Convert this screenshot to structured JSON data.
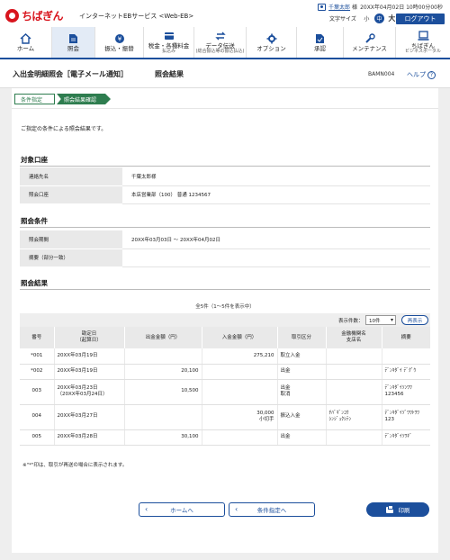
{
  "header": {
    "logo_text": "ちばぎん",
    "service_name": "インターネットEBサービス <Web-EB>",
    "user_name": "千葉太郎",
    "user_suffix": "様",
    "last_login": "20XX年04月02日 10時00分00秒",
    "text_size_label": "文字サイズ",
    "text_size_small": "小",
    "text_size_mid": "中",
    "text_size_large": "大",
    "logout_label": "ログアウト"
  },
  "nav": {
    "items": [
      {
        "label": "ホーム",
        "sub": "",
        "icon": "home-icon"
      },
      {
        "label": "照会",
        "sub": "",
        "icon": "inquiry-icon"
      },
      {
        "label": "振込・振替",
        "sub": "",
        "icon": "transfer-icon"
      },
      {
        "label": "税金・各種料金",
        "sub": "払込み",
        "icon": "tax-payment-icon"
      },
      {
        "label": "データ伝送",
        "sub": "(総合振込等の振込払込)",
        "icon": "data-transmission-icon"
      },
      {
        "label": "オプション",
        "sub": "",
        "icon": "option-icon"
      },
      {
        "label": "承認",
        "sub": "",
        "icon": "approval-icon"
      },
      {
        "label": "メンテナンス",
        "sub": "",
        "icon": "maintenance-icon"
      },
      {
        "label": "ちばぎん",
        "sub": "ビジネスポータル",
        "icon": "portal-icon"
      }
    ]
  },
  "page": {
    "title": "入出金明細照会［電子メール通知］",
    "subtitle": "照会結果",
    "screen_id": "BAMN004",
    "help_label": "ヘルプ",
    "help_icon": "?"
  },
  "steps": [
    "条件指定",
    "照会結果確認"
  ],
  "intro": "ご指定の条件による照会結果です。",
  "account_section": {
    "title": "対象口座",
    "rows": [
      {
        "label": "連絡先名",
        "value": "千葉太郎様"
      },
      {
        "label": "照会口座",
        "value": "本店営業部（100） 普通 1234567"
      }
    ]
  },
  "condition_section": {
    "title": "照会条件",
    "rows": [
      {
        "label": "照会期間",
        "value": "20XX年03月03日 〜 20XX年04月02日"
      },
      {
        "label": "摘要（部分一致）",
        "value": ""
      }
    ]
  },
  "results_section": {
    "title": "照会結果",
    "count_note": "全5件（1〜5件を表示中）",
    "display_count_label": "表示件数：",
    "display_count_value": "10件",
    "redisplay_label": "再表示",
    "columns": [
      "番号",
      "勘定日\n（起算日）",
      "出金金額（円）",
      "入金金額（円）",
      "取引区分",
      "金融機関名\n支店名",
      "摘要"
    ],
    "rows": [
      {
        "no": "*001",
        "date": "20XX年03月19日",
        "out": "",
        "in": "275,210",
        "type": "取立入金",
        "bank": "",
        "memo": ""
      },
      {
        "no": "*002",
        "date": "20XX年03月19日",
        "out": "20,100",
        "in": "",
        "type": "出金",
        "bank": "",
        "memo": "ﾃﾞﾝｷﾀﾞｲ ﾃﾞｸﾞｳ"
      },
      {
        "no": "003",
        "date": "20XX年03月23日\n（20XX年03月24日）",
        "out": "10,500",
        "in": "",
        "type": "出金\n取消",
        "bank": "",
        "memo": "ﾃﾞﾝｷﾀﾞｲｿﾝﾜﾜ\n123456"
      },
      {
        "no": "004",
        "date": "20XX年03月27日",
        "out": "",
        "in": "30,000\n小切手",
        "type": "振込入金",
        "bank": "ﾁﾊﾞｷﾞﾝｺｳ\nｼﾝｼﾞｭｸｼﾃﾝ",
        "memo": "ﾃﾞﾝｷﾀﾞｲｿﾞﾜﾜﾄﾜﾜ\n123"
      },
      {
        "no": "005",
        "date": "20XX年03月28日",
        "out": "30,100",
        "in": "",
        "type": "出金",
        "bank": "",
        "memo": "ﾃﾞﾝｷﾀﾞｲｿﾜｷﾞ"
      }
    ]
  },
  "footnote": "※\"*\"印は、取引が再送の場合に表示されます。",
  "buttons": {
    "home": "ホームへ",
    "back": "条件指定へ",
    "print": "印刷"
  }
}
